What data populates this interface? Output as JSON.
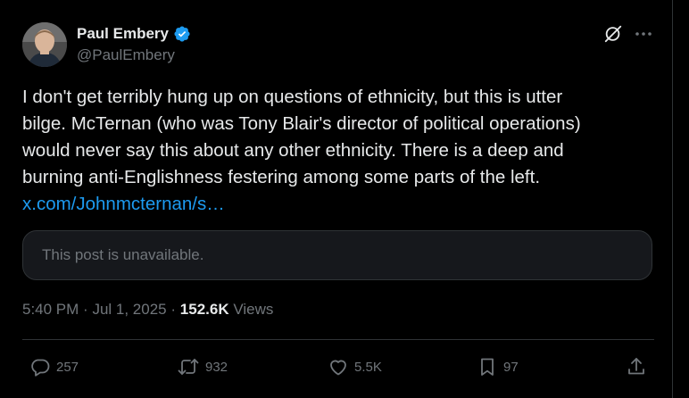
{
  "author": {
    "name": "Paul Embery",
    "handle": "@PaulEmbery"
  },
  "icons": {
    "verified": "verified-badge-icon",
    "grok": "grok-icon",
    "more": "more-icon",
    "reply": "reply-icon",
    "repost": "repost-icon",
    "like": "like-icon",
    "bookmark": "bookmark-icon",
    "share": "share-icon"
  },
  "colors": {
    "background": "#000000",
    "text": "#e7e9ea",
    "muted": "#71767b",
    "link": "#1d9bf0",
    "verified": "#1d9bf0",
    "border": "#2f3336"
  },
  "post": {
    "lines": [
      "I don't get terribly hung up on questions of ethnicity, but this is utter",
      "bilge. McTernan (who was Tony Blair's director of political operations)",
      "would never say this about any other ethnicity. There is a deep and",
      "burning anti-Englishness festering among some parts of the left."
    ],
    "link": "x.com/Johnmcternan/s…",
    "quote_unavailable": "This post is unavailable.",
    "time": "5:40 PM",
    "date": "Jul 1, 2025",
    "views_count": "152.6K",
    "views_label": "Views",
    "separator": "·"
  },
  "actions": {
    "replies": "257",
    "reposts": "932",
    "likes": "5.5K",
    "bookmarks": "97"
  }
}
